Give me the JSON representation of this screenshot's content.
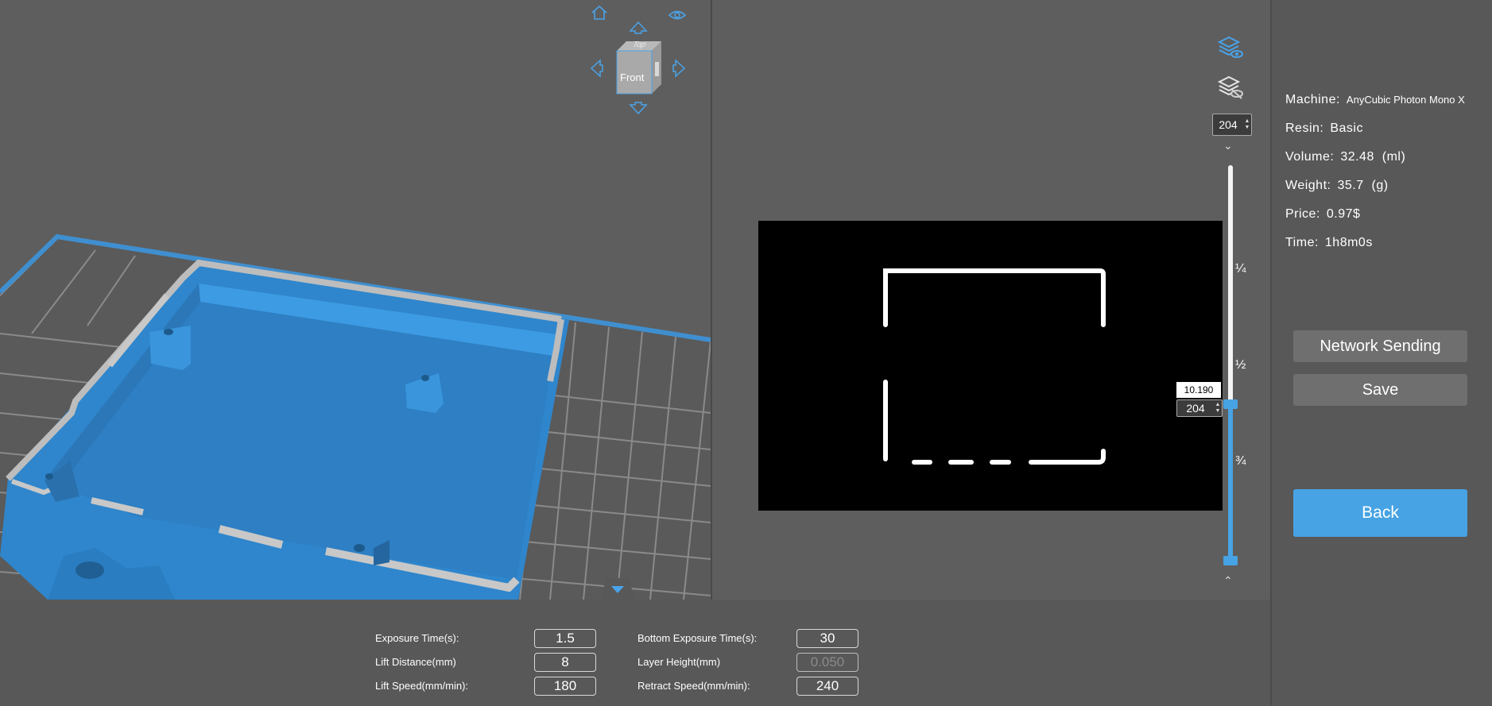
{
  "view_cube": {
    "top_face": "Top",
    "front_face": "Front"
  },
  "preview": {
    "layer_top": "204",
    "layer_current": "204",
    "layer_height_mm": "10.190",
    "marks": [
      "¼",
      "½",
      "¾"
    ],
    "slider_position_fraction": 0.5
  },
  "settings": {
    "exposure_time_label": "Exposure Time(s):",
    "exposure_time_value": "1.5",
    "lift_distance_label": "Lift Distance(mm)",
    "lift_distance_value": "8",
    "lift_speed_label": "Lift Speed(mm/min):",
    "lift_speed_value": "180",
    "bottom_exposure_label": "Bottom Exposure Time(s):",
    "bottom_exposure_value": "30",
    "layer_height_label": "Layer Height(mm)",
    "layer_height_value": "0.050",
    "retract_speed_label": "Retract Speed(mm/min):",
    "retract_speed_value": "240"
  },
  "info": {
    "machine_label": "Machine:",
    "machine_value": "AnyCubic Photon Mono X",
    "resin_label": "Resin:",
    "resin_value": "Basic",
    "volume_label": "Volume:",
    "volume_value": "32.48  (ml)",
    "weight_label": "Weight:",
    "weight_value": "35.7  (g)",
    "price_label": "Price:",
    "price_value": "0.97$",
    "time_label": "Time:",
    "time_value": "1h8m0s"
  },
  "buttons": {
    "network_sending": "Network Sending",
    "save": "Save",
    "back": "Back"
  },
  "colors": {
    "accent": "#47a3e3",
    "model": "#2f8bd2",
    "background": "#5e5e5e",
    "panel": "#585858"
  }
}
